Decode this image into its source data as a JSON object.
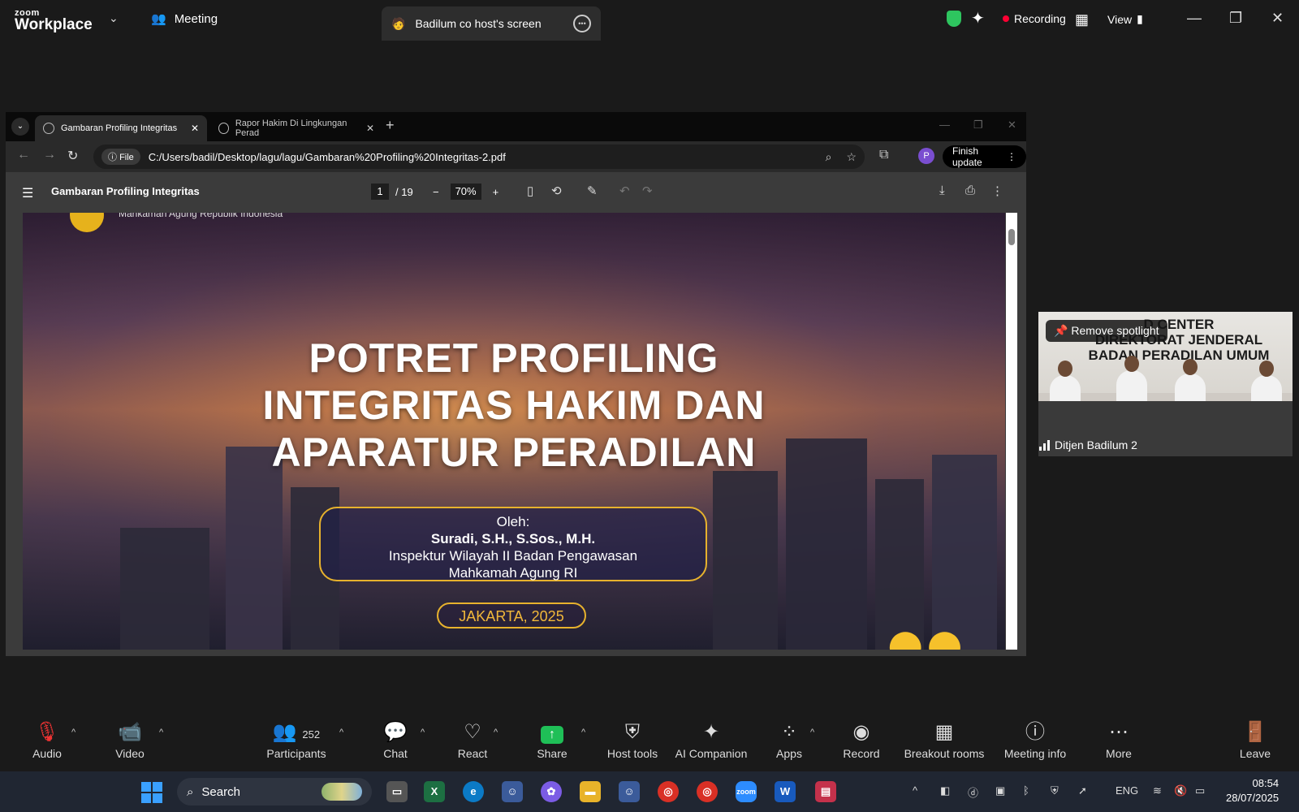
{
  "zoom": {
    "logo_top": "zoom",
    "logo_bottom": "Workplace",
    "meeting_tab": "Meeting",
    "share_tab": "Badilum co host's screen",
    "recording": "Recording",
    "view": "View"
  },
  "browser": {
    "tabs": [
      {
        "label": "Gambaran Profiling Integritas"
      },
      {
        "label": "Rapor Hakim Di Lingkungan Perad"
      }
    ],
    "file_chip": "File",
    "url": "C:/Users/badil/Desktop/lagu/lagu/Gambaran%20Profiling%20Integritas-2.pdf",
    "avatar_letter": "P",
    "finish_update": "Finish update"
  },
  "pdf": {
    "title": "Gambaran Profiling Integritas",
    "page_current": "1",
    "page_total": "/ 19",
    "zoom": "70%"
  },
  "slide": {
    "org": "Mahkamah Agung Republik Indonesia",
    "title_1": "POTRET PROFILING",
    "title_2": "INTEGRITAS HAKIM DAN",
    "title_3": "APARATUR PERADILAN",
    "oleh": "Oleh:",
    "name": "Suradi, S.H., S.Sos., M.H.",
    "role_1": "Inspektur Wilayah II Badan Pengawasan",
    "role_2": "Mahkamah Agung RI",
    "place_year": "JAKARTA, 2025"
  },
  "video": {
    "sign_1": "D CENTER",
    "sign_2": "DIREKTORAT JENDERAL",
    "sign_3": "BADAN PERADILAN UMUM",
    "remove_spotlight": "Remove spotlight",
    "participant_name": "Ditjen Badilum 2"
  },
  "toolbar": {
    "audio": "Audio",
    "video": "Video",
    "participants": "Participants",
    "participants_count": "252",
    "chat": "Chat",
    "react": "React",
    "share": "Share",
    "host_tools": "Host tools",
    "ai_companion": "AI Companion",
    "apps": "Apps",
    "record": "Record",
    "breakout_rooms": "Breakout rooms",
    "meeting_info": "Meeting info",
    "more": "More",
    "leave": "Leave"
  },
  "taskbar": {
    "search": "Search",
    "language": "ENG",
    "time": "08:54",
    "date": "28/07/2025"
  },
  "colors": {
    "zoom_bg": "#1a1a1a",
    "share_green": "#1fbf57",
    "record_red": "#ff0033",
    "slide_gold": "#e7b22d"
  }
}
